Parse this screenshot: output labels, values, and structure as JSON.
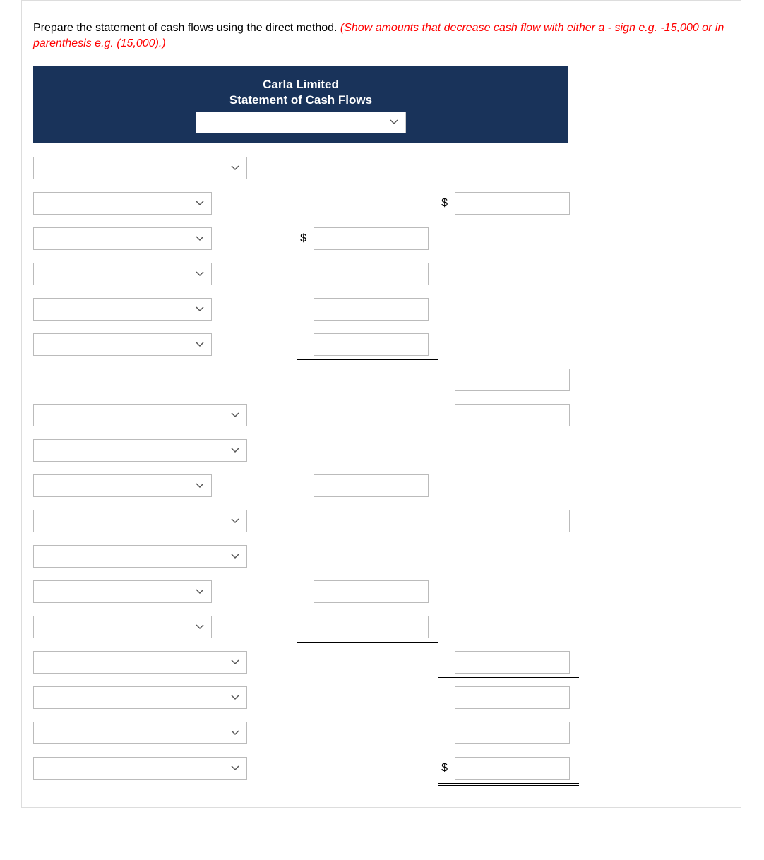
{
  "question": {
    "text_main": "Prepare the statement of cash flows using the direct method. ",
    "text_hint": "(Show amounts that decrease cash flow with either a - sign e.g. -15,000 or in parenthesis e.g. (15,000).)"
  },
  "header": {
    "company": "Carla Limited",
    "statement": "Statement of Cash Flows",
    "period_value": ""
  },
  "rows": [
    {
      "label_width": "wide",
      "label_value": "",
      "mid": null,
      "right": null
    },
    {
      "label_width": "narrow",
      "label_value": "",
      "mid": null,
      "right": {
        "dollar": true,
        "value": "",
        "underline": ""
      }
    },
    {
      "label_width": "narrow",
      "label_value": "",
      "mid": {
        "dollar": true,
        "value": "",
        "underline": ""
      },
      "right": null
    },
    {
      "label_width": "narrow",
      "label_value": "",
      "mid": {
        "dollar": false,
        "value": "",
        "underline": ""
      },
      "right": null
    },
    {
      "label_width": "narrow",
      "label_value": "",
      "mid": {
        "dollar": false,
        "value": "",
        "underline": ""
      },
      "right": null
    },
    {
      "label_width": "narrow",
      "label_value": "",
      "mid": {
        "dollar": false,
        "value": "",
        "underline": "single"
      },
      "right": null
    },
    {
      "label_width": "none",
      "label_value": "",
      "mid": null,
      "right": {
        "dollar": false,
        "value": "",
        "underline": "single"
      }
    },
    {
      "label_width": "wide",
      "label_value": "",
      "mid": null,
      "right": {
        "dollar": false,
        "value": "",
        "underline": ""
      }
    },
    {
      "label_width": "wide",
      "label_value": "",
      "mid": null,
      "right": null
    },
    {
      "label_width": "narrow",
      "label_value": "",
      "mid": {
        "dollar": false,
        "value": "",
        "underline": "single"
      },
      "right": null
    },
    {
      "label_width": "wide",
      "label_value": "",
      "mid": null,
      "right": {
        "dollar": false,
        "value": "",
        "underline": ""
      }
    },
    {
      "label_width": "wide",
      "label_value": "",
      "mid": null,
      "right": null
    },
    {
      "label_width": "narrow",
      "label_value": "",
      "mid": {
        "dollar": false,
        "value": "",
        "underline": ""
      },
      "right": null
    },
    {
      "label_width": "narrow",
      "label_value": "",
      "mid": {
        "dollar": false,
        "value": "",
        "underline": "single"
      },
      "right": null
    },
    {
      "label_width": "wide",
      "label_value": "",
      "mid": null,
      "right": {
        "dollar": false,
        "value": "",
        "underline": "single"
      }
    },
    {
      "label_width": "wide",
      "label_value": "",
      "mid": null,
      "right": {
        "dollar": false,
        "value": "",
        "underline": ""
      }
    },
    {
      "label_width": "wide",
      "label_value": "",
      "mid": null,
      "right": {
        "dollar": false,
        "value": "",
        "underline": "single"
      }
    },
    {
      "label_width": "wide",
      "label_value": "",
      "mid": null,
      "right": {
        "dollar": true,
        "value": "",
        "underline": "double"
      }
    }
  ]
}
